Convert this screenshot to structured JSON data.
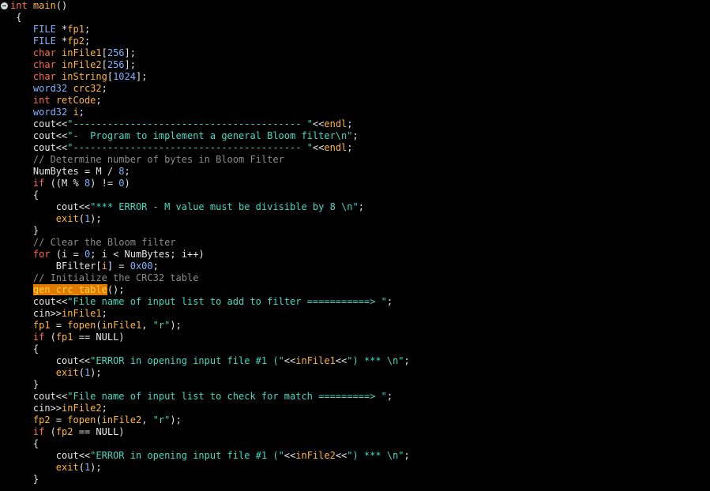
{
  "colors": {
    "background": "#000000",
    "keyword": "#ff6b4a",
    "type": "#7fb2ff",
    "identifier": "#ffb63d",
    "string": "#46d8c2",
    "number": "#7fb2ff",
    "comment": "#8c8c8c",
    "plain": "#e6e6e6",
    "highlight_bg": "#e07a00"
  },
  "gutter": {
    "fold_icon": "collapse-circle-icon"
  },
  "lines": [
    [
      [
        "kw",
        "int"
      ],
      [
        "pl",
        " "
      ],
      [
        "id",
        "main"
      ],
      [
        "pl",
        "()"
      ]
    ],
    [
      [
        "pl",
        " {"
      ]
    ],
    [
      [
        "pl",
        "    "
      ],
      [
        "ty",
        "FILE"
      ],
      [
        "pl",
        " *"
      ],
      [
        "id",
        "fp1"
      ],
      [
        "pl",
        ";"
      ]
    ],
    [
      [
        "pl",
        "    "
      ],
      [
        "ty",
        "FILE"
      ],
      [
        "pl",
        " *"
      ],
      [
        "id",
        "fp2"
      ],
      [
        "pl",
        ";"
      ]
    ],
    [
      [
        "pl",
        "    "
      ],
      [
        "kw",
        "char"
      ],
      [
        "pl",
        " "
      ],
      [
        "id",
        "inFile1"
      ],
      [
        "pl",
        "["
      ],
      [
        "nm",
        "256"
      ],
      [
        "pl",
        "];"
      ]
    ],
    [
      [
        "pl",
        "    "
      ],
      [
        "kw",
        "char"
      ],
      [
        "pl",
        " "
      ],
      [
        "id",
        "inFile2"
      ],
      [
        "pl",
        "["
      ],
      [
        "nm",
        "256"
      ],
      [
        "pl",
        "];"
      ]
    ],
    [
      [
        "pl",
        "    "
      ],
      [
        "kw",
        "char"
      ],
      [
        "pl",
        " "
      ],
      [
        "id",
        "inString"
      ],
      [
        "pl",
        "["
      ],
      [
        "nm",
        "1024"
      ],
      [
        "pl",
        "];"
      ]
    ],
    [
      [
        "pl",
        "    "
      ],
      [
        "ty",
        "word32"
      ],
      [
        "pl",
        " "
      ],
      [
        "id",
        "crc32"
      ],
      [
        "pl",
        ";"
      ]
    ],
    [
      [
        "pl",
        "    "
      ],
      [
        "kw",
        "int"
      ],
      [
        "pl",
        " "
      ],
      [
        "id",
        "retCode"
      ],
      [
        "pl",
        ";"
      ]
    ],
    [
      [
        "pl",
        "    "
      ],
      [
        "ty",
        "word32"
      ],
      [
        "pl",
        " "
      ],
      [
        "id",
        "i"
      ],
      [
        "pl",
        ";"
      ]
    ],
    [
      [
        "pl",
        "    cout<<"
      ],
      [
        "st",
        "\"---------------------------------------- \""
      ],
      [
        "pl",
        "<<"
      ],
      [
        "id",
        "endl"
      ],
      [
        "pl",
        ";"
      ]
    ],
    [
      [
        "pl",
        "    cout<<"
      ],
      [
        "st",
        "\"-  Program to implement a general Bloom filter\\n\""
      ],
      [
        "pl",
        ";"
      ]
    ],
    [
      [
        "pl",
        "    cout<<"
      ],
      [
        "st",
        "\"---------------------------------------- \""
      ],
      [
        "pl",
        "<<"
      ],
      [
        "id",
        "endl"
      ],
      [
        "pl",
        ";"
      ]
    ],
    [
      [
        "pl",
        "    "
      ],
      [
        "cm",
        "// Determine number of bytes in Bloom Filter"
      ]
    ],
    [
      [
        "pl",
        "    NumBytes = M / "
      ],
      [
        "nm",
        "8"
      ],
      [
        "pl",
        ";"
      ]
    ],
    [
      [
        "pl",
        "    "
      ],
      [
        "kw",
        "if"
      ],
      [
        "pl",
        " ((M % "
      ],
      [
        "nm",
        "8"
      ],
      [
        "pl",
        ") != "
      ],
      [
        "nm",
        "0"
      ],
      [
        "pl",
        ")"
      ]
    ],
    [
      [
        "pl",
        "    {"
      ]
    ],
    [
      [
        "pl",
        "        cout<<"
      ],
      [
        "st",
        "\"*** ERROR - M value must be divisible by 8 \\n\""
      ],
      [
        "pl",
        ";"
      ]
    ],
    [
      [
        "pl",
        "        "
      ],
      [
        "id",
        "exit"
      ],
      [
        "pl",
        "("
      ],
      [
        "nm",
        "1"
      ],
      [
        "pl",
        ");"
      ]
    ],
    [
      [
        "pl",
        "    }"
      ]
    ],
    [
      [
        "pl",
        "    "
      ],
      [
        "cm",
        "// Clear the Bloom filter"
      ]
    ],
    [
      [
        "pl",
        "    "
      ],
      [
        "kw",
        "for"
      ],
      [
        "pl",
        " (i = "
      ],
      [
        "nm",
        "0"
      ],
      [
        "pl",
        "; i < NumBytes; i++)"
      ]
    ],
    [
      [
        "pl",
        "        BFilter["
      ],
      [
        "id",
        "i"
      ],
      [
        "pl",
        "] = "
      ],
      [
        "nm",
        "0x00"
      ],
      [
        "pl",
        ";"
      ]
    ],
    [
      [
        "pl",
        "    "
      ],
      [
        "cm",
        "// Initialize the CRC32 table"
      ]
    ],
    [
      [
        "pl",
        "    "
      ],
      [
        "hl",
        "gen_crc_table"
      ],
      [
        "pl",
        "();"
      ]
    ],
    [
      [
        "pl",
        "    cout<<"
      ],
      [
        "st",
        "\"File name of input list to add to filter ===========> \""
      ],
      [
        "pl",
        ";"
      ]
    ],
    [
      [
        "pl",
        "    cin>>"
      ],
      [
        "id",
        "inFile1"
      ],
      [
        "pl",
        ";"
      ]
    ],
    [
      [
        "pl",
        "    "
      ],
      [
        "id",
        "fp1"
      ],
      [
        "pl",
        " = "
      ],
      [
        "id",
        "fopen"
      ],
      [
        "pl",
        "("
      ],
      [
        "id",
        "inFile1"
      ],
      [
        "pl",
        ", "
      ],
      [
        "st",
        "\"r\""
      ],
      [
        "pl",
        ");"
      ]
    ],
    [
      [
        "pl",
        "    "
      ],
      [
        "kw",
        "if"
      ],
      [
        "pl",
        " ("
      ],
      [
        "id",
        "fp1"
      ],
      [
        "pl",
        " == NULL)"
      ]
    ],
    [
      [
        "pl",
        "    {"
      ]
    ],
    [
      [
        "pl",
        "        cout<<"
      ],
      [
        "st",
        "\"ERROR in opening input file #1 (\""
      ],
      [
        "pl",
        "<<"
      ],
      [
        "id",
        "inFile1"
      ],
      [
        "pl",
        "<<"
      ],
      [
        "st",
        "\") *** \\n\""
      ],
      [
        "pl",
        ";"
      ]
    ],
    [
      [
        "pl",
        "        "
      ],
      [
        "id",
        "exit"
      ],
      [
        "pl",
        "("
      ],
      [
        "nm",
        "1"
      ],
      [
        "pl",
        ");"
      ]
    ],
    [
      [
        "pl",
        "    }"
      ]
    ],
    [
      [
        "pl",
        "    cout<<"
      ],
      [
        "st",
        "\"File name of input list to check for match =========> \""
      ],
      [
        "pl",
        ";"
      ]
    ],
    [
      [
        "pl",
        "    cin>>"
      ],
      [
        "id",
        "inFile2"
      ],
      [
        "pl",
        ";"
      ]
    ],
    [
      [
        "pl",
        "    "
      ],
      [
        "id",
        "fp2"
      ],
      [
        "pl",
        " = "
      ],
      [
        "id",
        "fopen"
      ],
      [
        "pl",
        "("
      ],
      [
        "id",
        "inFile2"
      ],
      [
        "pl",
        ", "
      ],
      [
        "st",
        "\"r\""
      ],
      [
        "pl",
        ");"
      ]
    ],
    [
      [
        "pl",
        "    "
      ],
      [
        "kw",
        "if"
      ],
      [
        "pl",
        " ("
      ],
      [
        "id",
        "fp2"
      ],
      [
        "pl",
        " == NULL)"
      ]
    ],
    [
      [
        "pl",
        "    {"
      ]
    ],
    [
      [
        "pl",
        "        cout<<"
      ],
      [
        "st",
        "\"ERROR in opening input file #1 (\""
      ],
      [
        "pl",
        "<<"
      ],
      [
        "id",
        "inFile2"
      ],
      [
        "pl",
        "<<"
      ],
      [
        "st",
        "\") *** \\n\""
      ],
      [
        "pl",
        ";"
      ]
    ],
    [
      [
        "pl",
        "        "
      ],
      [
        "id",
        "exit"
      ],
      [
        "pl",
        "("
      ],
      [
        "nm",
        "1"
      ],
      [
        "pl",
        ");"
      ]
    ],
    [
      [
        "pl",
        "    }"
      ]
    ]
  ]
}
